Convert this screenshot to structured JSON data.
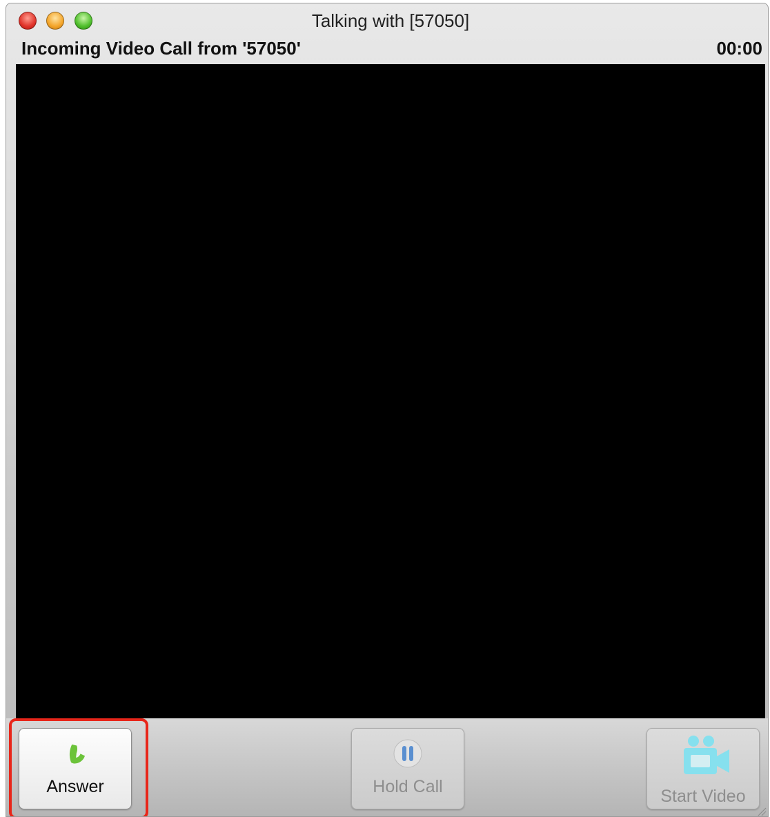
{
  "window": {
    "title": "Talking with [57050]"
  },
  "call": {
    "status": "Incoming Video Call from '57050'",
    "timer": "00:00"
  },
  "toolbar": {
    "answer_label": "Answer",
    "hold_label": "Hold Call",
    "video_label": "Start Video"
  },
  "icons": {
    "answer": "phone-icon",
    "hold": "pause-icon",
    "video": "video-camera-icon"
  },
  "colors": {
    "highlight": "#e8261a",
    "phone_icon": "#6cc33a",
    "hold_icon": "#5a8fd0",
    "video_icon": "#86e0ee"
  }
}
